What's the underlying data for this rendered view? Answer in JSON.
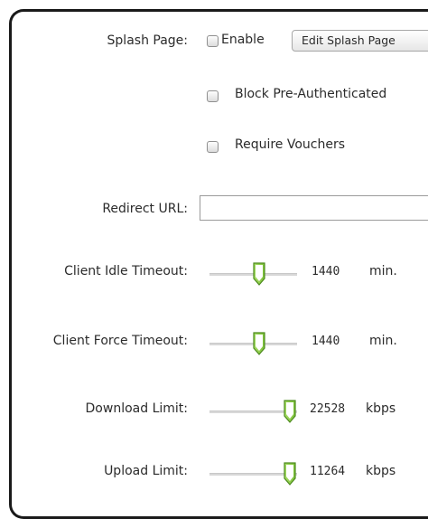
{
  "splash": {
    "label": "Splash Page:",
    "enable_label": "Enable",
    "enable_checked": false,
    "edit_button": "Edit Splash Page",
    "block_label": "Block Pre-Authenticated",
    "block_checked": false,
    "vouchers_label": "Require Vouchers",
    "vouchers_checked": false
  },
  "redirect": {
    "label": "Redirect URL:",
    "value": ""
  },
  "sliders": [
    {
      "label": "Client Idle Timeout:",
      "value": "1440",
      "unit": "min.",
      "fraction": 0.58
    },
    {
      "label": "Client Force Timeout:",
      "value": "1440",
      "unit": "min.",
      "fraction": 0.58
    },
    {
      "label": "Download Limit:",
      "value": "22528",
      "unit": "kbps",
      "fraction": 1.0
    },
    {
      "label": "Upload Limit:",
      "value": "11264",
      "unit": "kbps",
      "fraction": 1.0
    }
  ],
  "colors": {
    "thumb_green": "#7ec23a",
    "thumb_border": "#4d8a1f"
  }
}
